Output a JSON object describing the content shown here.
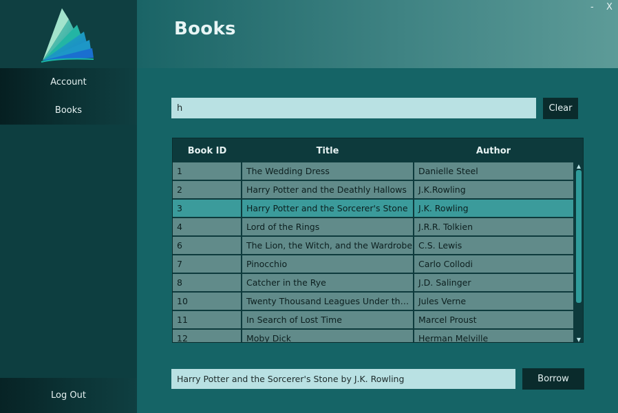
{
  "window": {
    "minimize_label": "-",
    "close_label": "X"
  },
  "sidebar": {
    "logo_icon": "book-pages-logo",
    "items": [
      {
        "label": "Account"
      },
      {
        "label": "Books"
      }
    ],
    "logout_label": "Log Out"
  },
  "header": {
    "title": "Books"
  },
  "search": {
    "value": "h"
  },
  "clear_label": "Clear",
  "table": {
    "columns": [
      "Book ID",
      "Title",
      "Author"
    ],
    "rows": [
      {
        "id": "1",
        "title": "The Wedding Dress",
        "author": "Danielle Steel"
      },
      {
        "id": "2",
        "title": "Harry Potter and the Deathly Hallows",
        "author": "J.K.Rowling"
      },
      {
        "id": "3",
        "title": "Harry Potter and the Sorcerer's Stone",
        "author": "J.K. Rowling",
        "selected": true
      },
      {
        "id": "4",
        "title": "Lord of the Rings",
        "author": "J.R.R. Tolkien"
      },
      {
        "id": "6",
        "title": "The Lion, the Witch, and the Wardrobe",
        "author": "C.S. Lewis"
      },
      {
        "id": "7",
        "title": "Pinocchio",
        "author": "Carlo Collodi"
      },
      {
        "id": "8",
        "title": "Catcher in the Rye",
        "author": "J.D. Salinger"
      },
      {
        "id": "10",
        "title": "Twenty Thousand Leagues Under the Sea",
        "author": "Jules Verne"
      },
      {
        "id": "11",
        "title": "In Search of Lost Time",
        "author": "Marcel Proust"
      },
      {
        "id": "12",
        "title": "Moby Dick",
        "author": "Herman Melville"
      }
    ]
  },
  "selection": {
    "value": "Harry Potter and the Sorcerer's Stone by J.K. Rowling"
  },
  "borrow_label": "Borrow",
  "colors": {
    "sidebar": "#0d3e40",
    "content_bg": "#156466",
    "row": "#618b8a",
    "row_selected": "#3b9b9b",
    "input_bg": "#b9e1e3",
    "button_bg": "#0a2b2c"
  }
}
